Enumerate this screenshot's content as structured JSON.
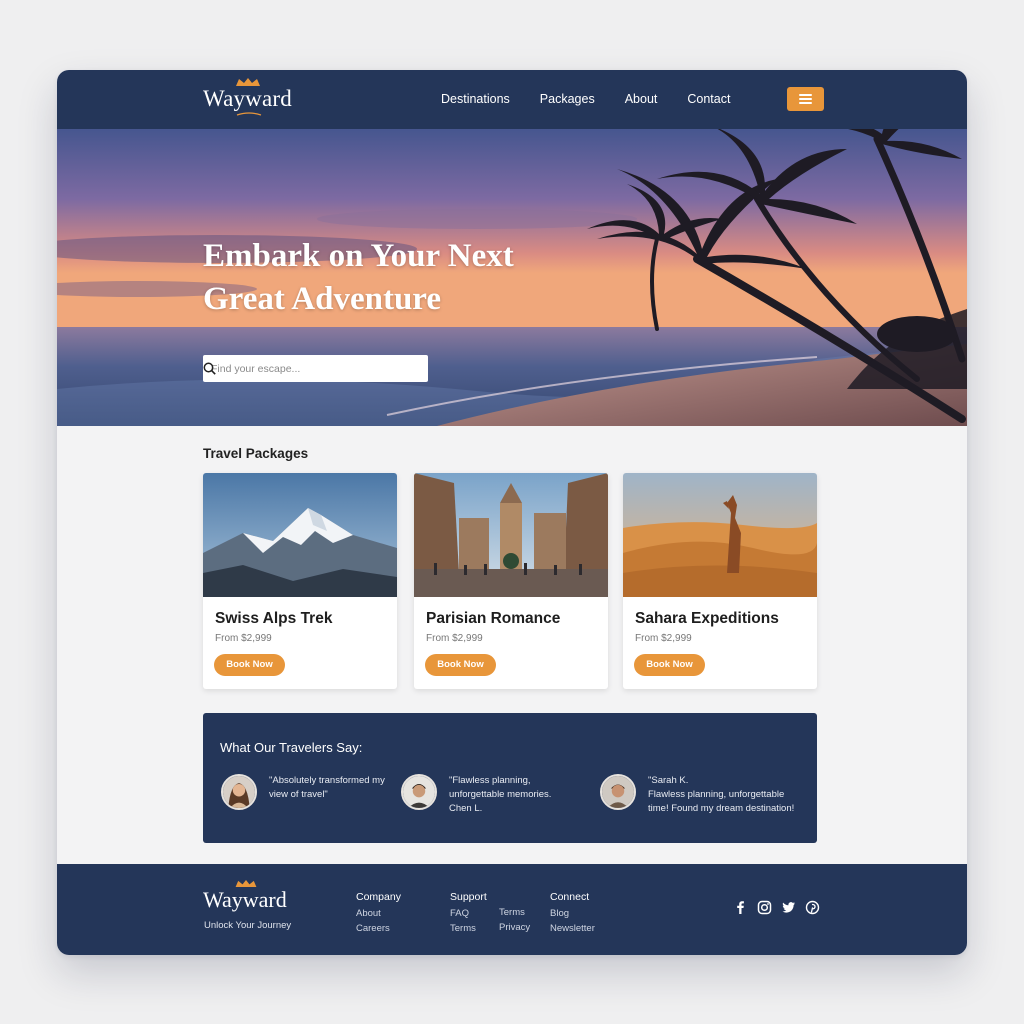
{
  "nav": {
    "logo": "Wayward",
    "links": [
      "Destinations",
      "Packages",
      "About",
      "Contact"
    ],
    "menu_icon": "hamburger-icon"
  },
  "hero": {
    "title_line1": "Embark on Your Next",
    "title_line2": "Great Adventure",
    "search_placeholder": "Find your escape...",
    "search_icon": "search-icon"
  },
  "packages": {
    "heading": "Travel Packages",
    "items": [
      {
        "title": "Swiss Alps Trek",
        "price": "From $2,999",
        "button": "Book Now"
      },
      {
        "title": "Parisian Romance",
        "price": "From $2,999",
        "button": "Book Now"
      },
      {
        "title": "Sahara Expeditions",
        "price": "From $2,999",
        "button": "Book Now"
      }
    ]
  },
  "testimonials": {
    "heading": "What Our Travelers Say:",
    "items": [
      {
        "quote": "\"Absolutely transformed my view of travel\"",
        "name": ""
      },
      {
        "quote": "\"Flawless planning, unforgettable memories.",
        "name": "Chen L."
      },
      {
        "quote": "Flawless planning, unforgettable time! Found my dream destination!",
        "name": "\"Sarah K."
      }
    ]
  },
  "footer": {
    "logo": "Wayward",
    "tagline": "Unlock Your Journey",
    "columns": [
      {
        "heading": "Company",
        "links": [
          "About",
          "Careers"
        ]
      },
      {
        "heading": "Support",
        "links": [
          "FAQ",
          "Terms"
        ]
      },
      {
        "heading": "",
        "links": [
          "Terms",
          "Privacy"
        ]
      },
      {
        "heading": "Connect",
        "links": [
          "Blog",
          "Newsletter"
        ]
      }
    ],
    "social_icons": [
      "facebook-icon",
      "instagram-icon",
      "twitter-icon",
      "pinterest-icon"
    ]
  },
  "colors": {
    "navy": "#243659",
    "accent": "#e8963a",
    "page_bg": "#efeff0"
  }
}
